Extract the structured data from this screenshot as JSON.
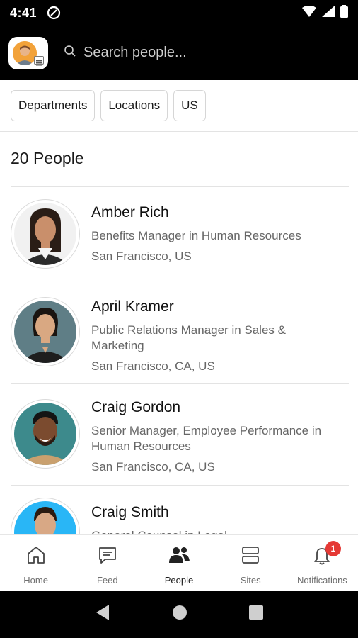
{
  "status_bar": {
    "time": "4:41",
    "icons": [
      "at-sign-icon",
      "wifi-icon",
      "signal-icon",
      "battery-icon"
    ]
  },
  "header": {
    "search_placeholder": "Search people..."
  },
  "filters": [
    {
      "label": "Departments"
    },
    {
      "label": "Locations"
    },
    {
      "label": "US"
    }
  ],
  "people_count": "20 People",
  "people": [
    {
      "name": "Amber Rich",
      "title": "Benefits Manager in Human Resources",
      "location": "San Francisco, US"
    },
    {
      "name": "April Kramer",
      "title": "Public Relations Manager in Sales & Marketing",
      "location": "San Francisco, CA, US"
    },
    {
      "name": "Craig Gordon",
      "title": "Senior Manager, Employee Performance in Human Resources",
      "location": "San Francisco, CA, US"
    },
    {
      "name": "Craig Smith",
      "title": "General Counsel in Legal",
      "location": ""
    }
  ],
  "bottom_nav": [
    {
      "label": "Home",
      "icon": "home-icon"
    },
    {
      "label": "Feed",
      "icon": "chat-icon"
    },
    {
      "label": "People",
      "icon": "people-icon",
      "active": true
    },
    {
      "label": "Sites",
      "icon": "sites-icon"
    },
    {
      "label": "Notifications",
      "icon": "bell-icon",
      "badge": "1"
    }
  ],
  "colors": {
    "header_bg": "#000000",
    "badge": "#e53935",
    "avatar_blue": "#29b6f6"
  }
}
